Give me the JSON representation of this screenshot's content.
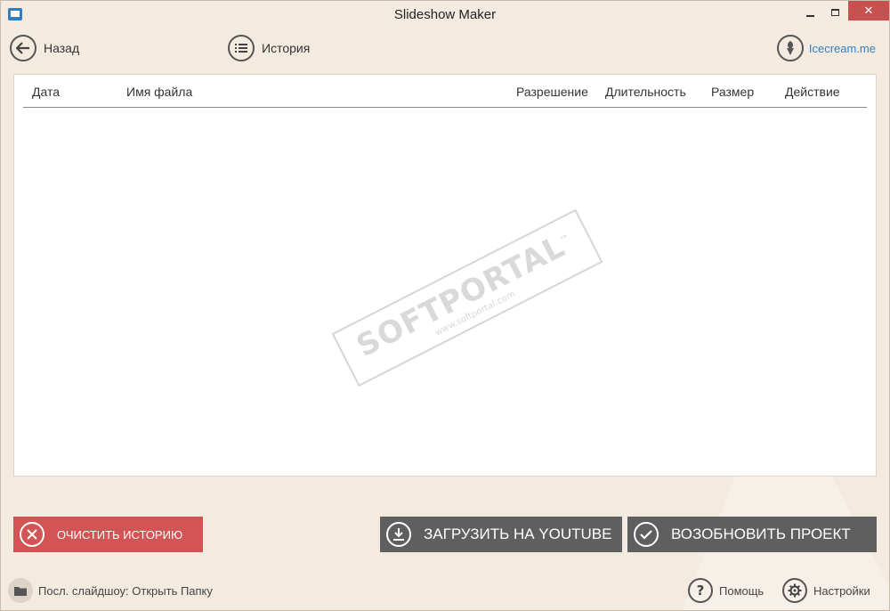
{
  "window": {
    "title": "Slideshow Maker"
  },
  "nav": {
    "back_label": "Назад",
    "history_label": "История",
    "brand_label": "Icecream.me"
  },
  "table": {
    "columns": [
      "Дата",
      "Имя файла",
      "Разрешение",
      "Длительность",
      "Размер",
      "Действие"
    ],
    "rows": []
  },
  "watermark": {
    "main": "SOFTPORTAL",
    "sub": "www.softportal.com",
    "tm": "™"
  },
  "actions": {
    "clear_label": "ОЧИСТИТЬ ИСТОРИЮ",
    "upload_label": "ЗАГРУЗИТЬ НА YOUTUBE",
    "resume_label": "ВОЗОБНОВИТЬ ПРОЕКТ"
  },
  "footer": {
    "last_slideshow": "Посл. слайдшоу: Открыть Папку",
    "help_label": "Помощь",
    "settings_label": "Настройки"
  },
  "colors": {
    "background": "#f3ebe0",
    "clear_button": "#d35454",
    "dark_button": "#5f5f5f",
    "link": "#2f7fc1",
    "close_button": "#c75050"
  }
}
